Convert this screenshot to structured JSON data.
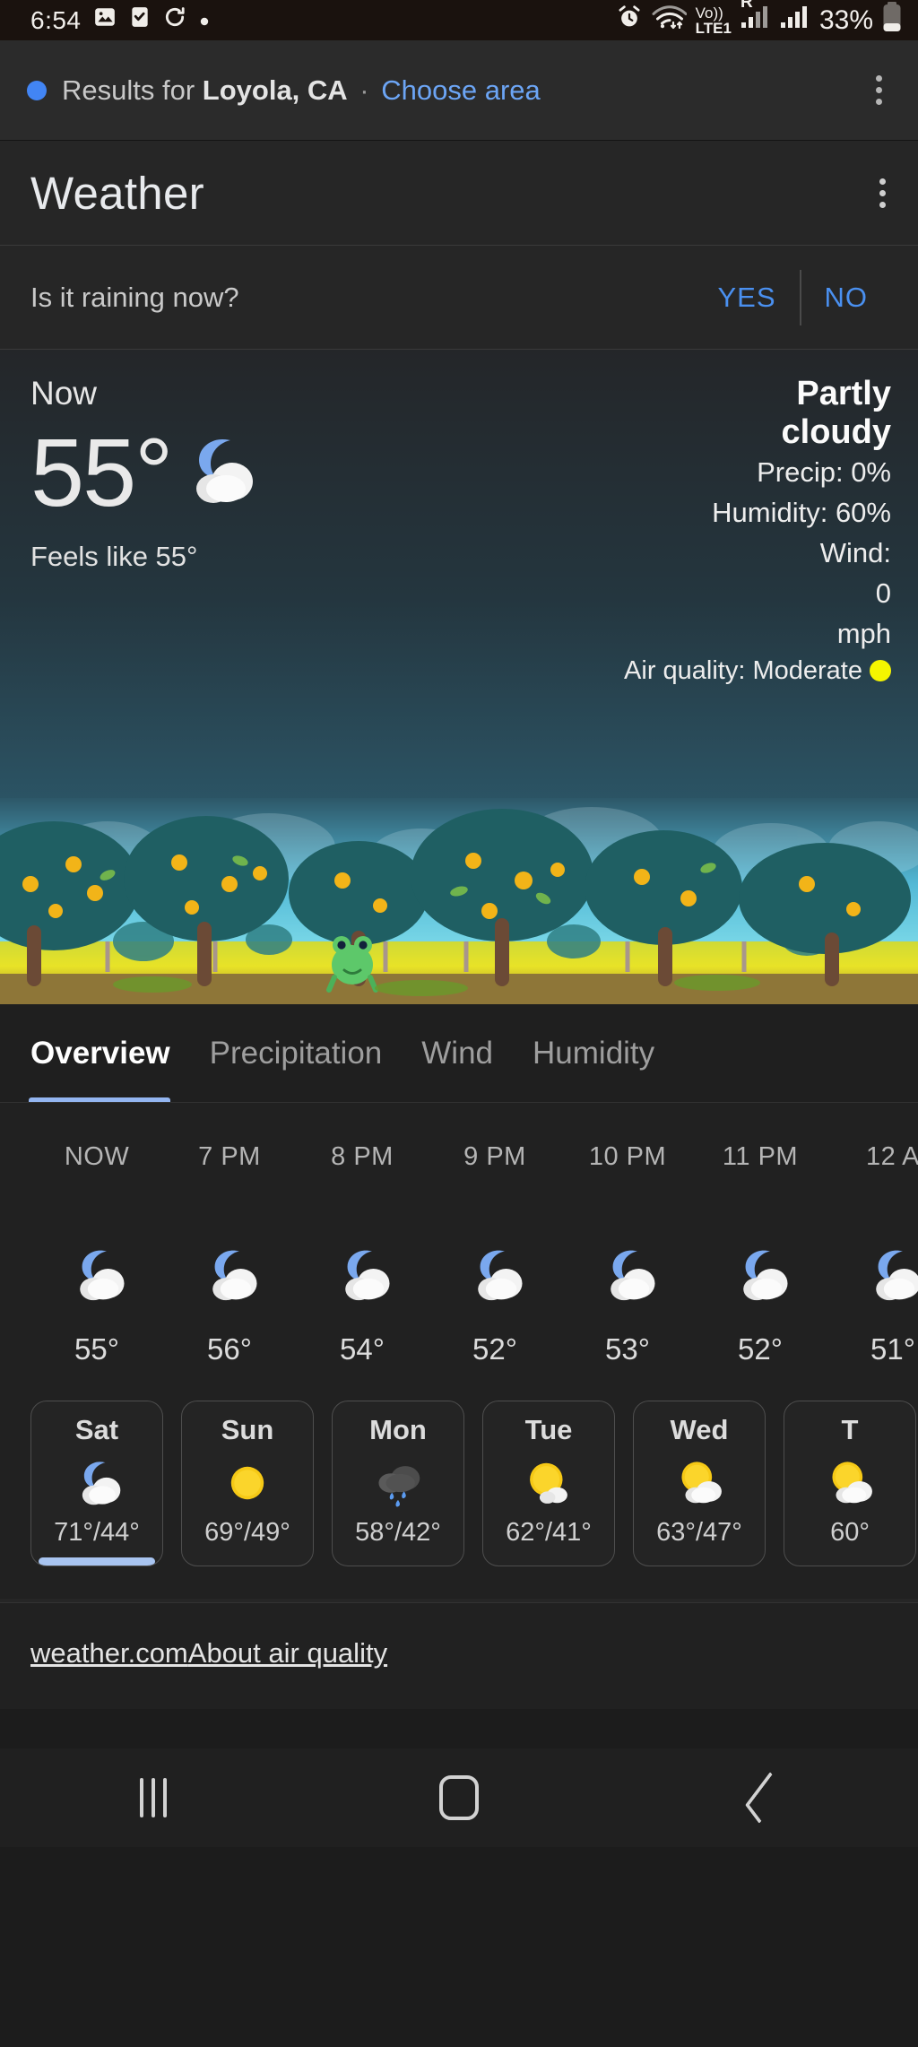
{
  "status_bar": {
    "time": "6:54",
    "left_icons": [
      "image-icon",
      "checkbox-icon",
      "sync-icon",
      "dot-icon"
    ],
    "alarm_icon": "alarm-icon",
    "wifi_icon": "wifi-icon",
    "volte_label": "Vo))",
    "network_label": "LTE1",
    "roaming_label": "R",
    "battery_percent": "33%"
  },
  "results_bar": {
    "prefix": "Results for ",
    "location": "Loyola, CA",
    "separator": " · ",
    "choose_area": "Choose area",
    "menu_icon": "overflow-menu-icon"
  },
  "header": {
    "title": "Weather",
    "menu_icon": "overflow-menu-icon"
  },
  "raining_prompt": {
    "question": "Is it raining now?",
    "yes_label": "YES",
    "no_label": "NO"
  },
  "current": {
    "now_label": "Now",
    "temperature": "55°",
    "icon": "partly-cloudy-night-icon",
    "feels_like": "Feels like 55°",
    "condition_line1": "Partly",
    "condition_line2": "cloudy",
    "precip": "Precip: 0%",
    "humidity": "Humidity: 60%",
    "wind_label": "Wind:",
    "wind_value": "0",
    "wind_unit": "mph",
    "air_quality": "Air quality: Moderate",
    "air_quality_color": "#f5f500"
  },
  "tabs": [
    {
      "label": "Overview",
      "active": true
    },
    {
      "label": "Precipitation",
      "active": false
    },
    {
      "label": "Wind",
      "active": false
    },
    {
      "label": "Humidity",
      "active": false
    }
  ],
  "hourly": [
    {
      "time": "NOW",
      "temp": "55°",
      "icon": "partly-cloudy-night-icon"
    },
    {
      "time": "7 PM",
      "temp": "56°",
      "icon": "partly-cloudy-night-icon"
    },
    {
      "time": "8 PM",
      "temp": "54°",
      "icon": "partly-cloudy-night-icon"
    },
    {
      "time": "9 PM",
      "temp": "52°",
      "icon": "partly-cloudy-night-icon"
    },
    {
      "time": "10 PM",
      "temp": "53°",
      "icon": "partly-cloudy-night-icon"
    },
    {
      "time": "11 PM",
      "temp": "52°",
      "icon": "partly-cloudy-night-icon"
    },
    {
      "time": "12 A",
      "temp": "51°",
      "icon": "partly-cloudy-night-icon"
    }
  ],
  "daily": [
    {
      "day": "Sat",
      "temps": "71°/44°",
      "icon": "partly-cloudy-night-icon",
      "selected": true
    },
    {
      "day": "Sun",
      "temps": "69°/49°",
      "icon": "sunny-icon",
      "selected": false
    },
    {
      "day": "Mon",
      "temps": "58°/42°",
      "icon": "rain-icon",
      "selected": false
    },
    {
      "day": "Tue",
      "temps": "62°/41°",
      "icon": "mostly-sunny-icon",
      "selected": false
    },
    {
      "day": "Wed",
      "temps": "63°/47°",
      "icon": "partly-cloudy-day-icon",
      "selected": false
    },
    {
      "day": "T",
      "temps": "60°",
      "icon": "partly-cloudy-day-icon",
      "selected": false
    }
  ],
  "footer": {
    "source_link": "weather.com",
    "about_link": "About air quality"
  },
  "navbar": {
    "recents": "recents-icon",
    "home": "home-icon",
    "back": "back-icon"
  }
}
